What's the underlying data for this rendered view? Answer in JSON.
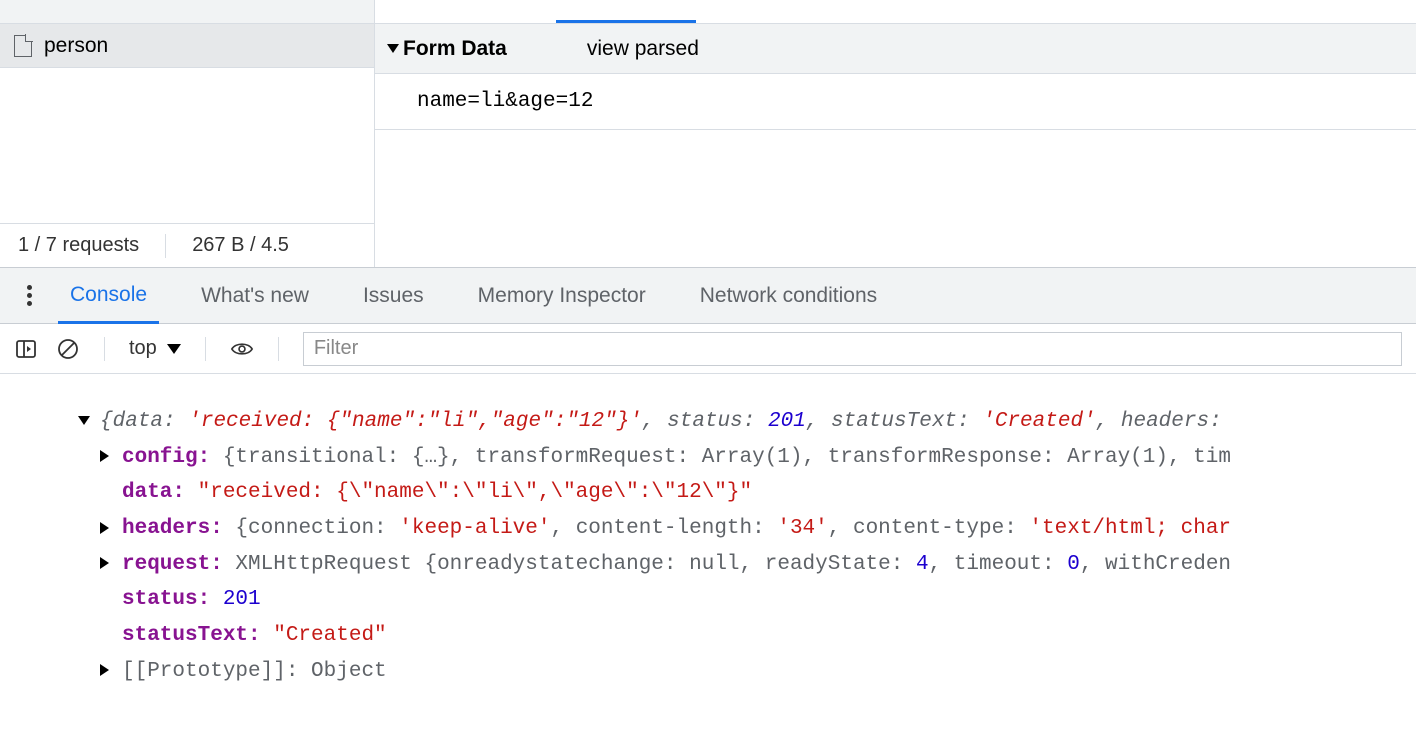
{
  "network": {
    "request_name": "person",
    "status_left": "1 / 7 requests",
    "status_right": "267 B / 4.5"
  },
  "formdata": {
    "title": "Form Data",
    "view_parsed": "view parsed",
    "body": "name=li&age=12"
  },
  "drawer_tabs": {
    "console": "Console",
    "whatsnew": "What's new",
    "issues": "Issues",
    "memory": "Memory Inspector",
    "netcond": "Network conditions"
  },
  "console_toolbar": {
    "context": "top",
    "filter_placeholder": "Filter"
  },
  "console": {
    "summary_prefix": "{",
    "summary_data_key": "data: ",
    "summary_data_val": "'received: {\"name\":\"li\",\"age\":\"12\"}'",
    "summary_mid1": ", ",
    "summary_status_key": "status: ",
    "summary_status_val": "201",
    "summary_mid2": ", ",
    "summary_st_key": "statusText: ",
    "summary_st_val": "'Created'",
    "summary_mid3": ", ",
    "summary_headers_key": "headers: ",
    "config_key": "config:",
    "config_val": " {transitional: {…}, transformRequest: Array(1), transformResponse: Array(1), tim",
    "data_key": "data:",
    "data_val": " \"received: {\\\"name\\\":\\\"li\\\",\\\"age\\\":\\\"12\\\"}\"",
    "headers_key": "headers:",
    "headers_val_a": " {connection: ",
    "headers_val_b": "'keep-alive'",
    "headers_val_c": ", content-length: ",
    "headers_val_d": "'34'",
    "headers_val_e": ", content-type: ",
    "headers_val_f": "'text/html; char",
    "request_key": "request:",
    "request_val_a": " XMLHttpRequest {onreadystatechange: ",
    "request_null": "null",
    "request_val_b": ", readyState: ",
    "request_rs": "4",
    "request_val_c": ", timeout: ",
    "request_to": "0",
    "request_val_d": ", withCreden",
    "status_key": "status:",
    "status_val": " 201",
    "statusText_key": "statusText:",
    "statusText_val": " \"Created\"",
    "proto_key": "[[Prototype]]:",
    "proto_val": " Object"
  }
}
